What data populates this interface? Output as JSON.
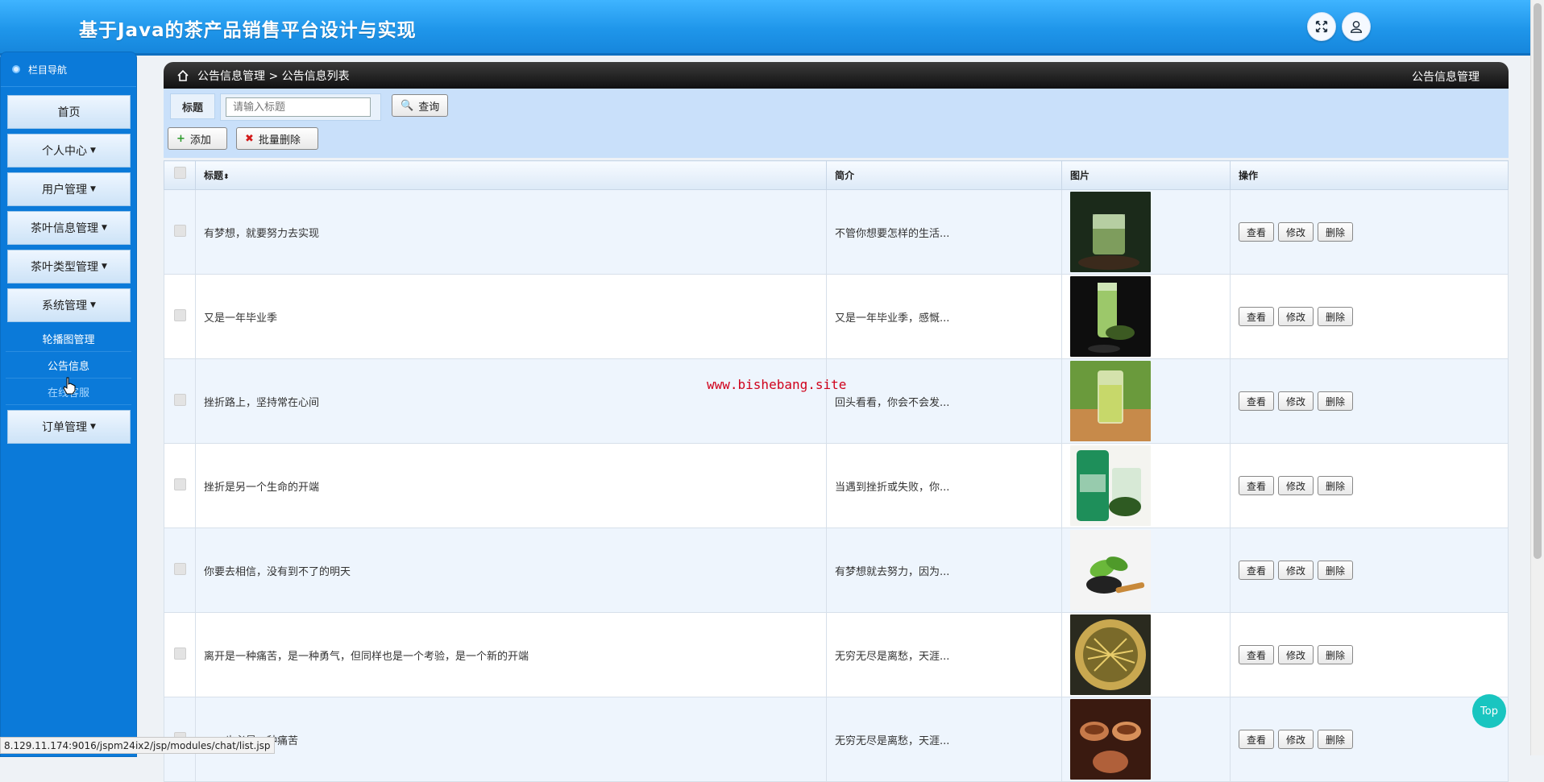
{
  "header": {
    "title": "基于Java的茶产品销售平台设计与实现",
    "fullscreen_icon": "fullscreen-icon",
    "user_icon": "user-icon"
  },
  "sidebar": {
    "heading": "栏目导航",
    "items": [
      {
        "label": "首页",
        "has_caret": false
      },
      {
        "label": "个人中心",
        "has_caret": true
      },
      {
        "label": "用户管理",
        "has_caret": true
      },
      {
        "label": "茶叶信息管理",
        "has_caret": true
      },
      {
        "label": "茶叶类型管理",
        "has_caret": true
      },
      {
        "label": "系统管理",
        "has_caret": true
      }
    ],
    "submenu": [
      "轮播图管理",
      "公告信息",
      "在线客服"
    ],
    "last_item": {
      "label": "订单管理",
      "has_caret": true
    }
  },
  "breadcrumb": {
    "path": "公告信息管理 > 公告信息列表",
    "right": "公告信息管理"
  },
  "search": {
    "label": "标题",
    "placeholder": "请输入标题",
    "button": "查询"
  },
  "actions": {
    "add": "添加",
    "batch_delete": "批量删除"
  },
  "table": {
    "headers": [
      "标题",
      "简介",
      "图片",
      "操作"
    ],
    "sort_mark": "⬍",
    "rows": [
      {
        "title": "有梦想，就要努力去实现",
        "intro": "不管你想要怎样的生活...",
        "image": "tea-glass-teapot"
      },
      {
        "title": "又是一年毕业季",
        "intro": "又是一年毕业季，感慨...",
        "image": "green-tea-tube"
      },
      {
        "title": "挫折路上，坚持常在心间",
        "intro": "回头看看，你会不会发...",
        "image": "tea-glass-garden"
      },
      {
        "title": "挫折是另一个生命的开端",
        "intro": "当遇到挫折或失败，你...",
        "image": "tea-canister"
      },
      {
        "title": "你要去相信，没有到不了的明天",
        "intro": "有梦想就去努力，因为...",
        "image": "tea-spoon-leaves"
      },
      {
        "title": "离开是一种痛苦，是一种勇气，但同样也是一个考验，是一个新的开端",
        "intro": "无穷无尽是离愁，天涯...",
        "image": "dry-tea-bowl"
      },
      {
        "title": "……也必是一种痛苦",
        "intro": "无穷无尽是离愁，天涯...",
        "image": "tea-cups"
      }
    ],
    "row_buttons": [
      "查看",
      "修改",
      "删除"
    ]
  },
  "watermark": "www.bishebang.site",
  "top_button": "Top",
  "status_url": "8.129.11.174:9016/jspm24ix2/jsp/modules/chat/list.jsp"
}
